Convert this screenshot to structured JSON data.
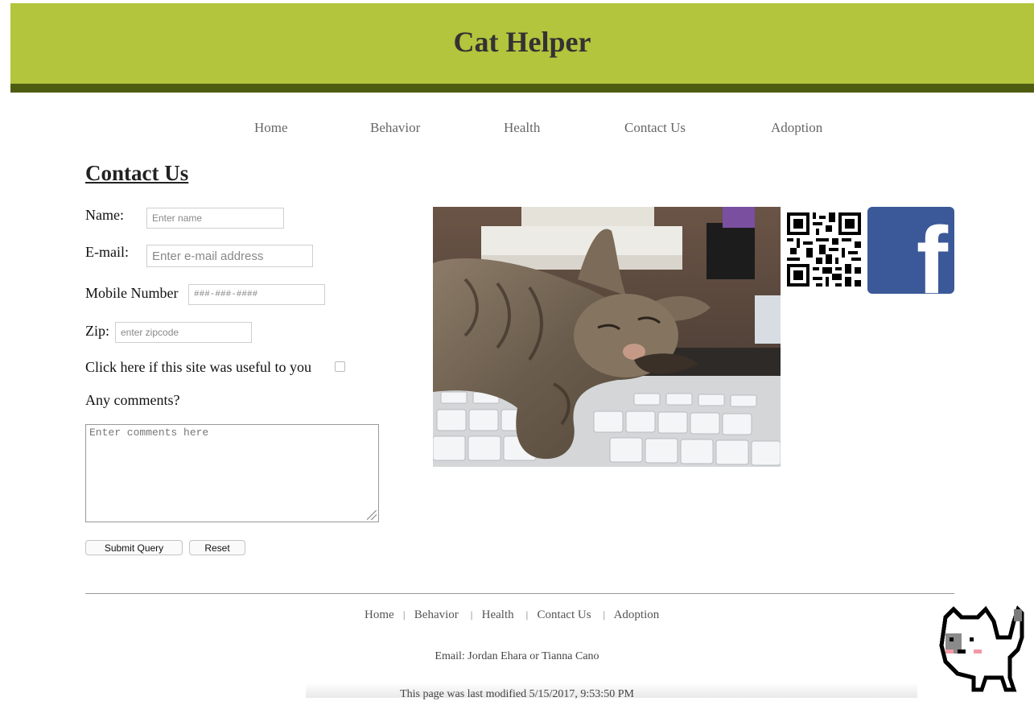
{
  "header": {
    "title": "Cat Helper",
    "accent_color": "#b3c43d",
    "bar_color": "#4e5c12"
  },
  "nav": {
    "items": [
      "Home",
      "Behavior",
      "Health",
      "Contact Us",
      "Adoption"
    ]
  },
  "page": {
    "heading": "Contact Us"
  },
  "form": {
    "name_label": "Name:",
    "name_placeholder": "Enter name",
    "email_label": "E-mail:",
    "email_placeholder": "Enter e-mail address",
    "mobile_label": "Mobile Number",
    "mobile_placeholder": "###-###-####",
    "zip_label": "Zip:",
    "zip_placeholder": "enter zipcode",
    "useful_label": "Click here if this site was useful to you",
    "useful_checked": false,
    "comments_label": "Any comments?",
    "comments_placeholder": "Enter comments here",
    "submit_label": "Submit Query",
    "reset_label": "Reset"
  },
  "media": {
    "photo_icon": "sleeping-cat-photo",
    "qr_icon": "qr-code-icon",
    "facebook_icon": "facebook-icon",
    "facebook_color": "#3b5998"
  },
  "footer": {
    "nav": [
      "Home",
      "Behavior",
      "Health",
      "Contact Us",
      "Adoption"
    ],
    "separator": "|",
    "email_line": "Email: Jordan Ehara or Tianna Cano",
    "modified": "This page was last modified 5/15/2017, 9:53:50 PM",
    "mascot_icon": "pixel-cat-icon"
  }
}
